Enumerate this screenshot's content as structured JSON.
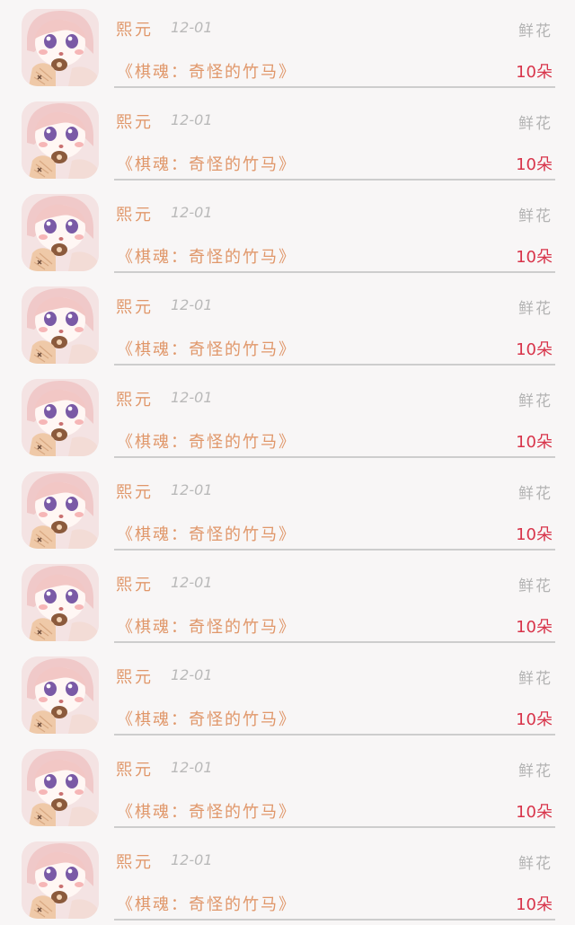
{
  "records": [
    {
      "user": "熙元",
      "date": "12-01",
      "gift_type": "鲜花",
      "book": "《棋魂：奇怪的竹马》",
      "amount": "10朵"
    },
    {
      "user": "熙元",
      "date": "12-01",
      "gift_type": "鲜花",
      "book": "《棋魂：奇怪的竹马》",
      "amount": "10朵"
    },
    {
      "user": "熙元",
      "date": "12-01",
      "gift_type": "鲜花",
      "book": "《棋魂：奇怪的竹马》",
      "amount": "10朵"
    },
    {
      "user": "熙元",
      "date": "12-01",
      "gift_type": "鲜花",
      "book": "《棋魂：奇怪的竹马》",
      "amount": "10朵"
    },
    {
      "user": "熙元",
      "date": "12-01",
      "gift_type": "鲜花",
      "book": "《棋魂：奇怪的竹马》",
      "amount": "10朵"
    },
    {
      "user": "熙元",
      "date": "12-01",
      "gift_type": "鲜花",
      "book": "《棋魂：奇怪的竹马》",
      "amount": "10朵"
    },
    {
      "user": "熙元",
      "date": "12-01",
      "gift_type": "鲜花",
      "book": "《棋魂：奇怪的竹马》",
      "amount": "10朵"
    },
    {
      "user": "熙元",
      "date": "12-01",
      "gift_type": "鲜花",
      "book": "《棋魂：奇怪的竹马》",
      "amount": "10朵"
    },
    {
      "user": "熙元",
      "date": "12-01",
      "gift_type": "鲜花",
      "book": "《棋魂：奇怪的竹马》",
      "amount": "10朵"
    },
    {
      "user": "熙元",
      "date": "12-01",
      "gift_type": "鲜花",
      "book": "《棋魂：奇怪的竹马》",
      "amount": "10朵"
    }
  ],
  "colors": {
    "background": "#f8f6f6",
    "name_text": "#e0976a",
    "book_text": "#e0976a",
    "amount_text": "#d8344a",
    "muted_text": "#b3b3b3",
    "divider": "#cdcdcd"
  },
  "icons": {
    "avatar": "anime-girl-avatar"
  }
}
